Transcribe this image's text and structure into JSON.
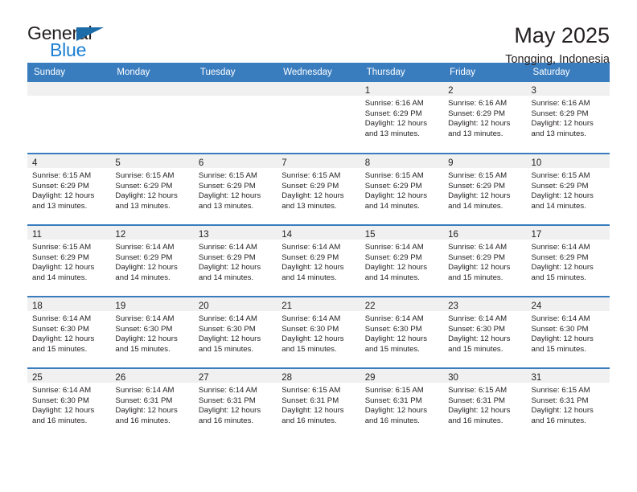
{
  "logo": {
    "word_one": "General",
    "word_two": "Blue",
    "triangle_color": "#1b6ca8",
    "blue_color": "#1b7fd4"
  },
  "header": {
    "title": "May 2025",
    "subtitle": "Tongging, Indonesia",
    "header_bg": "#3a7dbf",
    "header_text_color": "#ffffff",
    "daynum_band_bg": "#f0f0f0"
  },
  "weekdays": [
    "Sunday",
    "Monday",
    "Tuesday",
    "Wednesday",
    "Thursday",
    "Friday",
    "Saturday"
  ],
  "labels": {
    "sunrise": "Sunrise:",
    "sunset": "Sunset:",
    "daylight": "Daylight:"
  },
  "weeks": [
    [
      {
        "day": "",
        "empty": true
      },
      {
        "day": "",
        "empty": true
      },
      {
        "day": "",
        "empty": true
      },
      {
        "day": "",
        "empty": true
      },
      {
        "day": "1",
        "sunrise": "Sunrise: 6:16 AM",
        "sunset": "Sunset: 6:29 PM",
        "daylight_1": "Daylight: 12 hours",
        "daylight_2": "and 13 minutes."
      },
      {
        "day": "2",
        "sunrise": "Sunrise: 6:16 AM",
        "sunset": "Sunset: 6:29 PM",
        "daylight_1": "Daylight: 12 hours",
        "daylight_2": "and 13 minutes."
      },
      {
        "day": "3",
        "sunrise": "Sunrise: 6:16 AM",
        "sunset": "Sunset: 6:29 PM",
        "daylight_1": "Daylight: 12 hours",
        "daylight_2": "and 13 minutes."
      }
    ],
    [
      {
        "day": "4",
        "sunrise": "Sunrise: 6:15 AM",
        "sunset": "Sunset: 6:29 PM",
        "daylight_1": "Daylight: 12 hours",
        "daylight_2": "and 13 minutes."
      },
      {
        "day": "5",
        "sunrise": "Sunrise: 6:15 AM",
        "sunset": "Sunset: 6:29 PM",
        "daylight_1": "Daylight: 12 hours",
        "daylight_2": "and 13 minutes."
      },
      {
        "day": "6",
        "sunrise": "Sunrise: 6:15 AM",
        "sunset": "Sunset: 6:29 PM",
        "daylight_1": "Daylight: 12 hours",
        "daylight_2": "and 13 minutes."
      },
      {
        "day": "7",
        "sunrise": "Sunrise: 6:15 AM",
        "sunset": "Sunset: 6:29 PM",
        "daylight_1": "Daylight: 12 hours",
        "daylight_2": "and 13 minutes."
      },
      {
        "day": "8",
        "sunrise": "Sunrise: 6:15 AM",
        "sunset": "Sunset: 6:29 PM",
        "daylight_1": "Daylight: 12 hours",
        "daylight_2": "and 14 minutes."
      },
      {
        "day": "9",
        "sunrise": "Sunrise: 6:15 AM",
        "sunset": "Sunset: 6:29 PM",
        "daylight_1": "Daylight: 12 hours",
        "daylight_2": "and 14 minutes."
      },
      {
        "day": "10",
        "sunrise": "Sunrise: 6:15 AM",
        "sunset": "Sunset: 6:29 PM",
        "daylight_1": "Daylight: 12 hours",
        "daylight_2": "and 14 minutes."
      }
    ],
    [
      {
        "day": "11",
        "sunrise": "Sunrise: 6:15 AM",
        "sunset": "Sunset: 6:29 PM",
        "daylight_1": "Daylight: 12 hours",
        "daylight_2": "and 14 minutes."
      },
      {
        "day": "12",
        "sunrise": "Sunrise: 6:14 AM",
        "sunset": "Sunset: 6:29 PM",
        "daylight_1": "Daylight: 12 hours",
        "daylight_2": "and 14 minutes."
      },
      {
        "day": "13",
        "sunrise": "Sunrise: 6:14 AM",
        "sunset": "Sunset: 6:29 PM",
        "daylight_1": "Daylight: 12 hours",
        "daylight_2": "and 14 minutes."
      },
      {
        "day": "14",
        "sunrise": "Sunrise: 6:14 AM",
        "sunset": "Sunset: 6:29 PM",
        "daylight_1": "Daylight: 12 hours",
        "daylight_2": "and 14 minutes."
      },
      {
        "day": "15",
        "sunrise": "Sunrise: 6:14 AM",
        "sunset": "Sunset: 6:29 PM",
        "daylight_1": "Daylight: 12 hours",
        "daylight_2": "and 14 minutes."
      },
      {
        "day": "16",
        "sunrise": "Sunrise: 6:14 AM",
        "sunset": "Sunset: 6:29 PM",
        "daylight_1": "Daylight: 12 hours",
        "daylight_2": "and 15 minutes."
      },
      {
        "day": "17",
        "sunrise": "Sunrise: 6:14 AM",
        "sunset": "Sunset: 6:29 PM",
        "daylight_1": "Daylight: 12 hours",
        "daylight_2": "and 15 minutes."
      }
    ],
    [
      {
        "day": "18",
        "sunrise": "Sunrise: 6:14 AM",
        "sunset": "Sunset: 6:30 PM",
        "daylight_1": "Daylight: 12 hours",
        "daylight_2": "and 15 minutes."
      },
      {
        "day": "19",
        "sunrise": "Sunrise: 6:14 AM",
        "sunset": "Sunset: 6:30 PM",
        "daylight_1": "Daylight: 12 hours",
        "daylight_2": "and 15 minutes."
      },
      {
        "day": "20",
        "sunrise": "Sunrise: 6:14 AM",
        "sunset": "Sunset: 6:30 PM",
        "daylight_1": "Daylight: 12 hours",
        "daylight_2": "and 15 minutes."
      },
      {
        "day": "21",
        "sunrise": "Sunrise: 6:14 AM",
        "sunset": "Sunset: 6:30 PM",
        "daylight_1": "Daylight: 12 hours",
        "daylight_2": "and 15 minutes."
      },
      {
        "day": "22",
        "sunrise": "Sunrise: 6:14 AM",
        "sunset": "Sunset: 6:30 PM",
        "daylight_1": "Daylight: 12 hours",
        "daylight_2": "and 15 minutes."
      },
      {
        "day": "23",
        "sunrise": "Sunrise: 6:14 AM",
        "sunset": "Sunset: 6:30 PM",
        "daylight_1": "Daylight: 12 hours",
        "daylight_2": "and 15 minutes."
      },
      {
        "day": "24",
        "sunrise": "Sunrise: 6:14 AM",
        "sunset": "Sunset: 6:30 PM",
        "daylight_1": "Daylight: 12 hours",
        "daylight_2": "and 15 minutes."
      }
    ],
    [
      {
        "day": "25",
        "sunrise": "Sunrise: 6:14 AM",
        "sunset": "Sunset: 6:30 PM",
        "daylight_1": "Daylight: 12 hours",
        "daylight_2": "and 16 minutes."
      },
      {
        "day": "26",
        "sunrise": "Sunrise: 6:14 AM",
        "sunset": "Sunset: 6:31 PM",
        "daylight_1": "Daylight: 12 hours",
        "daylight_2": "and 16 minutes."
      },
      {
        "day": "27",
        "sunrise": "Sunrise: 6:14 AM",
        "sunset": "Sunset: 6:31 PM",
        "daylight_1": "Daylight: 12 hours",
        "daylight_2": "and 16 minutes."
      },
      {
        "day": "28",
        "sunrise": "Sunrise: 6:15 AM",
        "sunset": "Sunset: 6:31 PM",
        "daylight_1": "Daylight: 12 hours",
        "daylight_2": "and 16 minutes."
      },
      {
        "day": "29",
        "sunrise": "Sunrise: 6:15 AM",
        "sunset": "Sunset: 6:31 PM",
        "daylight_1": "Daylight: 12 hours",
        "daylight_2": "and 16 minutes."
      },
      {
        "day": "30",
        "sunrise": "Sunrise: 6:15 AM",
        "sunset": "Sunset: 6:31 PM",
        "daylight_1": "Daylight: 12 hours",
        "daylight_2": "and 16 minutes."
      },
      {
        "day": "31",
        "sunrise": "Sunrise: 6:15 AM",
        "sunset": "Sunset: 6:31 PM",
        "daylight_1": "Daylight: 12 hours",
        "daylight_2": "and 16 minutes."
      }
    ]
  ]
}
